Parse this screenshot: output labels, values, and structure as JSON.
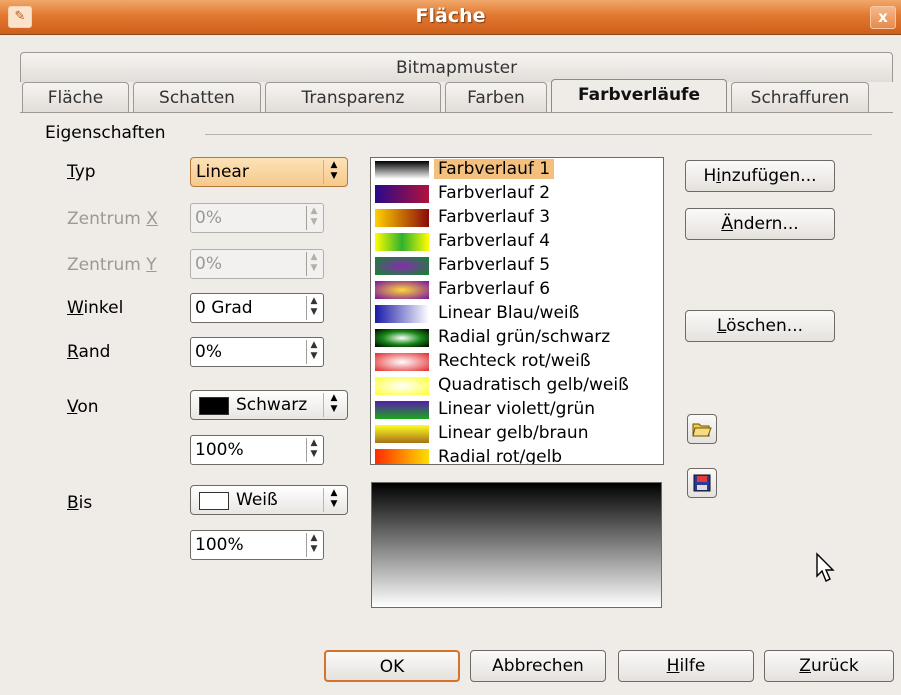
{
  "window": {
    "title": "Fläche",
    "app_icon": "app-icon",
    "close_icon": "close-icon",
    "close_glyph": "x"
  },
  "tabs": {
    "bitmap": "Bitmapmuster",
    "row": [
      {
        "label": "Fläche",
        "active": false
      },
      {
        "label": "Schatten",
        "active": false
      },
      {
        "label": "Transparenz",
        "active": false
      },
      {
        "label": "Farben",
        "active": false
      },
      {
        "label": "Farbverläufe",
        "active": true
      },
      {
        "label": "Schraffuren",
        "active": false
      }
    ]
  },
  "properties": {
    "heading": "Eigenschaften",
    "typ": {
      "label_pre": "",
      "label_key": "T",
      "label_post": "yp",
      "value": "Linear"
    },
    "center_x": {
      "label_pre": "Zentrum ",
      "label_key": "X",
      "label_post": "",
      "value": "0%"
    },
    "center_y": {
      "label_pre": "Zentrum ",
      "label_key": "Y",
      "label_post": "",
      "value": "0%"
    },
    "angle": {
      "label_pre": "",
      "label_key": "W",
      "label_post": "inkel",
      "value": "0 Grad"
    },
    "border": {
      "label_pre": "",
      "label_key": "R",
      "label_post": "and",
      "value": "0%"
    },
    "from": {
      "label_pre": "",
      "label_key": "V",
      "label_post": "on",
      "color_name": "Schwarz",
      "color": "#000000",
      "intensity": "100%"
    },
    "to": {
      "label_pre": "",
      "label_key": "B",
      "label_post": "is",
      "color_name": "Weiß",
      "color": "#ffffff",
      "intensity": "100%"
    }
  },
  "gradients": [
    {
      "label": "Farbverlauf 1",
      "selected": true,
      "css": "linear-gradient(#000,#fff)"
    },
    {
      "label": "Farbverlauf 2",
      "selected": false,
      "css": "linear-gradient(90deg,#2a0a8a,#b0123c)"
    },
    {
      "label": "Farbverlauf 3",
      "selected": false,
      "css": "linear-gradient(90deg,#ffd000,#8a0a0a)"
    },
    {
      "label": "Farbverlauf 4",
      "selected": false,
      "css": "linear-gradient(90deg,#ffff00,#2fb12f,#ffff00)"
    },
    {
      "label": "Farbverlauf 5",
      "selected": false,
      "css": "radial-gradient(#8a2ab0,#0e8a2e)"
    },
    {
      "label": "Farbverlauf 6",
      "selected": false,
      "css": "radial-gradient(#ffd93a,#7a10a0)"
    },
    {
      "label": "Linear Blau/weiß",
      "selected": false,
      "css": "linear-gradient(90deg,#1a1aa8,#ffffff)"
    },
    {
      "label": "Radial grün/schwarz",
      "selected": false,
      "css": "radial-gradient(#ffffff,#1a8a1a 50%,#000)"
    },
    {
      "label": "Rechteck rot/weiß",
      "selected": false,
      "css": "radial-gradient(#fff,#e22a2a)"
    },
    {
      "label": "Quadratisch gelb/weiß",
      "selected": false,
      "css": "radial-gradient(#fff,#ffff33)"
    },
    {
      "label": "Linear violett/grün",
      "selected": false,
      "css": "linear-gradient(#5a1ab0,#1aa81a)"
    },
    {
      "label": "Linear gelb/braun",
      "selected": false,
      "css": "linear-gradient(#ffff20,#a8701a)"
    },
    {
      "label": "Radial rot/gelb",
      "selected": false,
      "css": "linear-gradient(90deg,#ff2a00,#ffdf00)"
    }
  ],
  "side_buttons": {
    "add": {
      "pre": "H",
      "key": "i",
      "post": "nzufügen..."
    },
    "modify": {
      "pre": "",
      "key": "Ä",
      "post": "ndern..."
    },
    "delete": {
      "pre": "",
      "key": "L",
      "post": "öschen..."
    },
    "open_icon": "open-folder-icon",
    "save_icon": "save-disk-icon"
  },
  "footer": {
    "ok": "OK",
    "cancel": "Abbrechen",
    "help": {
      "pre": "",
      "key": "H",
      "post": "ilfe"
    },
    "back": {
      "pre": "",
      "key": "Z",
      "post": "urück"
    }
  },
  "colors": {
    "titlebar": "#e2782f",
    "selection": "#f4c07d",
    "default_button_border": "#d2742d"
  }
}
